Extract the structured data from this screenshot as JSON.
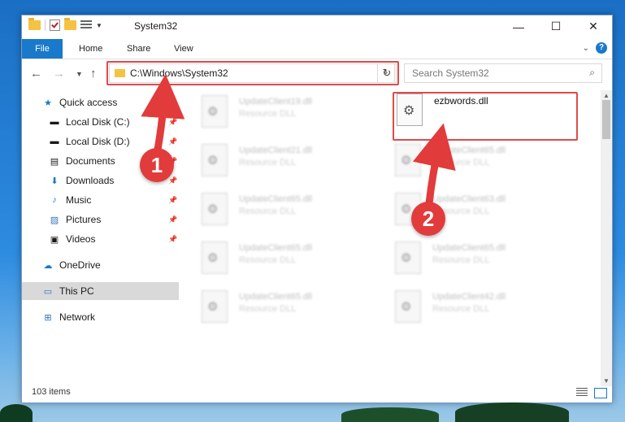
{
  "window": {
    "title": "System32",
    "minimize": "—",
    "maximize": "☐",
    "close": "✕"
  },
  "ribbon": {
    "tabs": [
      "File",
      "Home",
      "Share",
      "View"
    ],
    "help": "?"
  },
  "address": {
    "path": "C:\\Windows\\System32",
    "search_placeholder": "Search System32"
  },
  "sidebar": {
    "items": [
      {
        "label": "Quick access",
        "icon": "star-icon"
      },
      {
        "label": "Local Disk (C:)",
        "icon": "drive-icon",
        "pinned": true
      },
      {
        "label": "Local Disk (D:)",
        "icon": "drive-icon",
        "pinned": true
      },
      {
        "label": "Documents",
        "icon": "documents-icon",
        "pinned": true
      },
      {
        "label": "Downloads",
        "icon": "download-icon",
        "pinned": true
      },
      {
        "label": "Music",
        "icon": "music-icon",
        "pinned": true
      },
      {
        "label": "Pictures",
        "icon": "pictures-icon",
        "pinned": true
      },
      {
        "label": "Videos",
        "icon": "videos-icon",
        "pinned": true
      },
      {
        "label": "OneDrive",
        "icon": "cloud-icon"
      },
      {
        "label": "This PC",
        "icon": "computer-icon",
        "selected": true
      },
      {
        "label": "Network",
        "icon": "network-icon"
      }
    ]
  },
  "files": [
    {
      "name": "UpdateClient19.dll",
      "desc": "Resource DLL"
    },
    {
      "name": "UpdateClient21.dll",
      "desc": "Resource DLL"
    },
    {
      "name": "UpdateClient65.dll",
      "desc": "Resource DLL"
    },
    {
      "name": "UpdateClient65.dll",
      "desc": "Resource DLL"
    },
    {
      "name": "UpdateClient65.dll",
      "desc": "Resource DLL"
    },
    {
      "name": "UpdateClient65.dll",
      "desc": "Resource DLL"
    },
    {
      "name": "UpdateClient63.dll",
      "desc": "Resource DLL"
    },
    {
      "name": "UpdateClient65.dll",
      "desc": "Resource DLL"
    },
    {
      "name": "UpdateClient42.dll",
      "desc": "Resource DLL"
    }
  ],
  "featured_file": {
    "name": "ezbwords.dll"
  },
  "status": {
    "item_count": "103 items"
  },
  "annotations": {
    "step1": "1",
    "step2": "2",
    "color": "#e23b3b"
  }
}
